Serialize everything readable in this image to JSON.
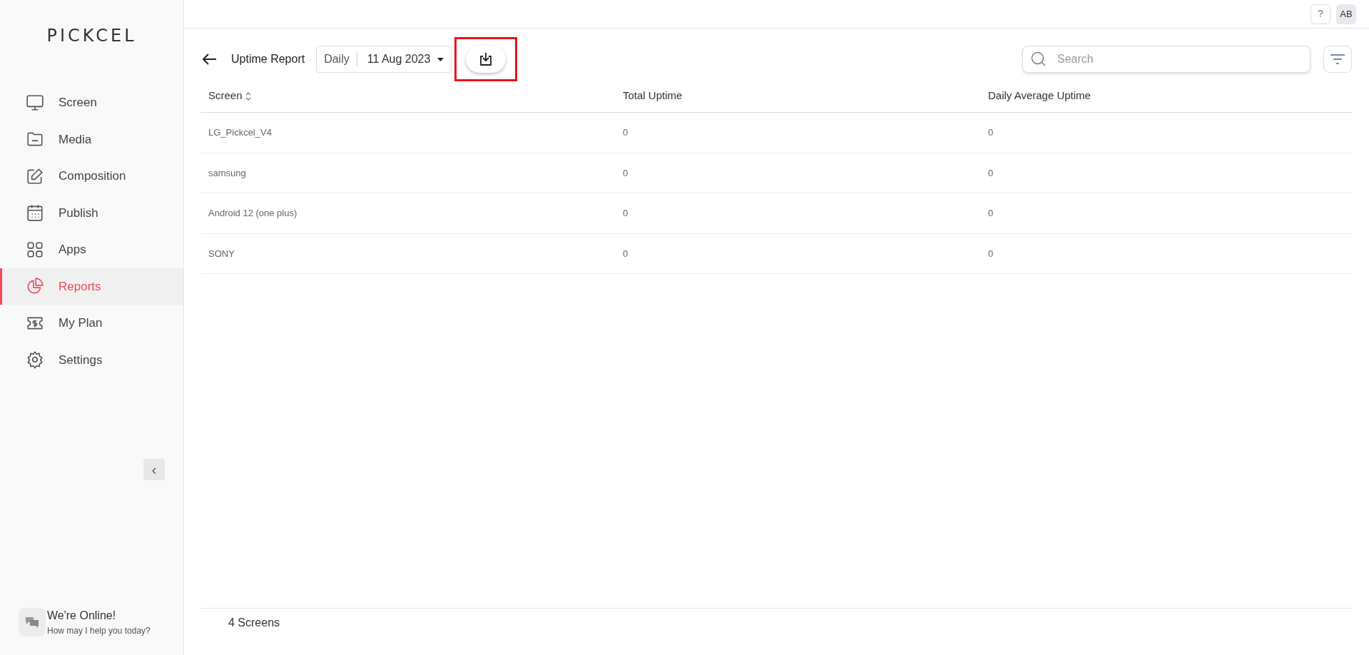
{
  "logo": "PICKCEL",
  "sidebar": {
    "items": [
      {
        "label": "Screen",
        "selected": false
      },
      {
        "label": "Media",
        "selected": false
      },
      {
        "label": "Composition",
        "selected": false
      },
      {
        "label": "Publish",
        "selected": false
      },
      {
        "label": "Apps",
        "selected": false
      },
      {
        "label": "Reports",
        "selected": true
      },
      {
        "label": "My Plan",
        "selected": false
      },
      {
        "label": "Settings",
        "selected": false
      }
    ],
    "collapse_button": "‹"
  },
  "chat": {
    "title": "We're Online!",
    "subtitle": "How may I help you today?"
  },
  "topbar": {
    "help": "?",
    "avatar": "AB"
  },
  "toolbar": {
    "title": "Uptime Report",
    "period": "Daily",
    "date": "11 Aug 2023",
    "download_highlighted": true,
    "search": {
      "placeholder": "Search"
    }
  },
  "table": {
    "columns": [
      "Screen",
      "Total Uptime",
      "Daily Average Uptime"
    ],
    "rows": [
      [
        "LG_Pickcel_V4",
        "0",
        "0"
      ],
      [
        "samsung",
        "0",
        "0"
      ],
      [
        "Android 12 (one plus)",
        "0",
        "0"
      ],
      [
        "SONY",
        "0",
        "0"
      ]
    ]
  },
  "footer": "4 Screens"
}
